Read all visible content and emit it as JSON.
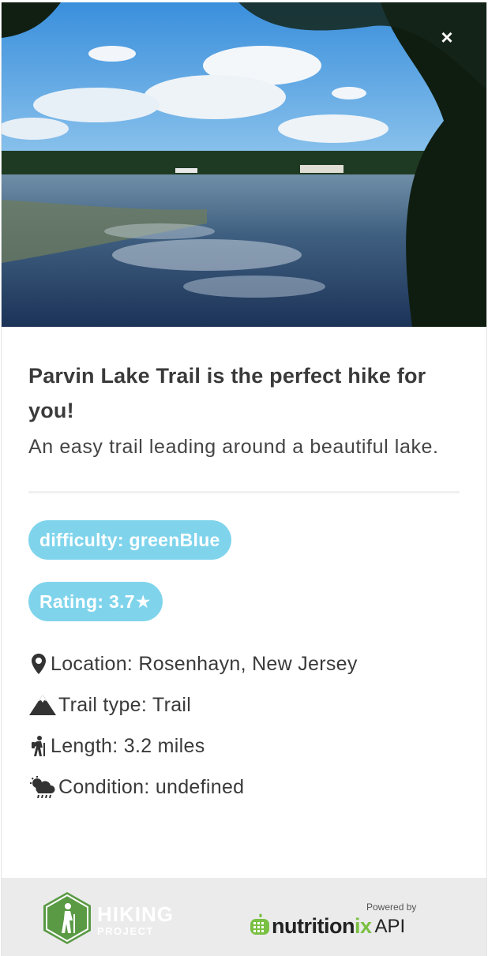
{
  "hero": {
    "close_label": "×",
    "image": "lake with trees and reflections"
  },
  "trail": {
    "title": "Parvin Lake Trail is the perfect hike for you!",
    "summary": "An easy trail leading around a beautiful lake.",
    "difficulty_badge": "difficulty: greenBlue",
    "rating_badge": "Rating: 3.7★",
    "location": "Location: Rosenhayn, New Jersey",
    "trail_type": "Trail type: Trail",
    "length": "Length: 3.2 miles",
    "condition": "Condition: undefined"
  },
  "colors": {
    "badge": "#7fd4ec",
    "footer_bg": "#ebebeb",
    "hiking_green": "#5a9a45",
    "nutritionix_green": "#7ac043"
  },
  "footer": {
    "hiking_project": {
      "line1": "HIKING",
      "line2": "PROJECT"
    },
    "nutritionix": {
      "powered_by": "Powered by",
      "brand_a": "nutrition",
      "brand_b": "ix",
      "brand_c": "API"
    }
  },
  "icons": [
    "close-icon",
    "map-pin-icon",
    "mountain-icon",
    "hiker-icon",
    "weather-icon",
    "hiking-project-logo-icon",
    "nutritionix-logo-icon"
  ]
}
